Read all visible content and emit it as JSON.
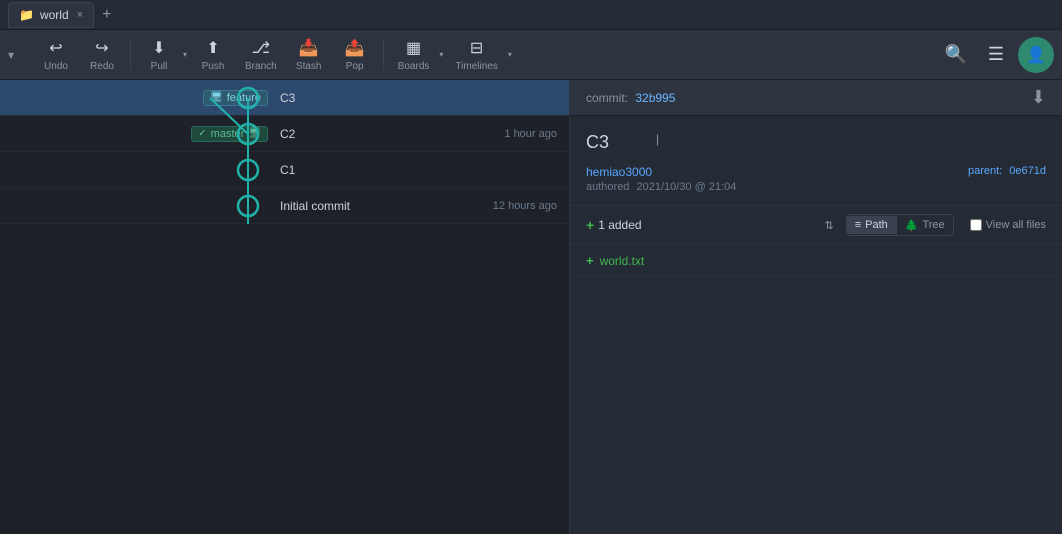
{
  "titlebar": {
    "tab": {
      "icon": "📁",
      "title": "world",
      "close": "×"
    },
    "add_tab": "+"
  },
  "toolbar": {
    "buttons": [
      {
        "id": "undo",
        "label": "Undo",
        "icon": "↩"
      },
      {
        "id": "redo",
        "label": "Redo",
        "icon": "↪"
      },
      {
        "id": "pull",
        "label": "Pull",
        "icon": "⬇",
        "has_arrow": true
      },
      {
        "id": "push",
        "label": "Push",
        "icon": "⬆"
      },
      {
        "id": "branch",
        "label": "Branch",
        "icon": "⎇"
      },
      {
        "id": "stash",
        "label": "Stash",
        "icon": "📥"
      },
      {
        "id": "pop",
        "label": "Pop",
        "icon": "📤"
      },
      {
        "id": "boards",
        "label": "Boards",
        "icon": "▦",
        "has_arrow": true
      },
      {
        "id": "timelines",
        "label": "Timelines",
        "icon": "⊟",
        "has_arrow": true
      }
    ],
    "search_icon": "🔍",
    "menu_icon": "☰",
    "avatar_icon": "👤"
  },
  "left_panel": {
    "branch_selector": {
      "arrow": "▾"
    },
    "commits": [
      {
        "id": "c3",
        "message": "C3",
        "time": "",
        "selected": true,
        "branch_label": "feature",
        "branch_type": "feature"
      },
      {
        "id": "c2",
        "message": "C2",
        "time": "1 hour ago",
        "selected": false,
        "branch_label": "master",
        "branch_type": "master"
      },
      {
        "id": "c1",
        "message": "C1",
        "time": "",
        "selected": false,
        "branch_label": null,
        "branch_type": null
      },
      {
        "id": "initial",
        "message": "Initial commit",
        "time": "12 hours ago",
        "selected": false,
        "branch_label": null,
        "branch_type": null
      }
    ]
  },
  "right_panel": {
    "commit_label": "commit:",
    "commit_hash": "32b995",
    "download_icon": "⬇",
    "commit_title": "C3",
    "author": {
      "name": "hemiao3000",
      "authored_label": "authored",
      "date": "2021/10/30 @ 21:04"
    },
    "parent_label": "parent:",
    "parent_hash": "0e671d",
    "files_added_icon": "+",
    "files_added_count": "1 added",
    "sort_icon": "⇅",
    "path_label": "Path",
    "tree_label": "Tree",
    "view_all_label": "View all files",
    "files": [
      {
        "status": "+",
        "name": "world.txt"
      }
    ]
  }
}
